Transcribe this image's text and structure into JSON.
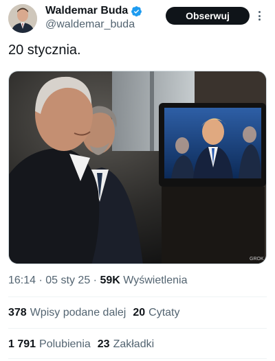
{
  "author": {
    "name": "Waldemar Buda",
    "handle": "@waldemar_buda",
    "verified_color": "#1d9bf0"
  },
  "follow_label": "Obserwuj",
  "tweet": {
    "text": "20 stycznia.",
    "image_watermark": "GROK"
  },
  "meta": {
    "time": "16:14",
    "separator": "·",
    "date": "05 sty 25",
    "views_count": "59K",
    "views_label": "Wyświetlenia"
  },
  "stats": {
    "reposts_count": "378",
    "reposts_label": "Wpisy podane dalej",
    "quotes_count": "20",
    "quotes_label": "Cytaty",
    "likes_count": "1 791",
    "likes_label": "Polubienia",
    "bookmarks_count": "23",
    "bookmarks_label": "Zakładki"
  },
  "icons": {
    "verified": "verified-badge-icon",
    "more": "more-options-icon"
  }
}
